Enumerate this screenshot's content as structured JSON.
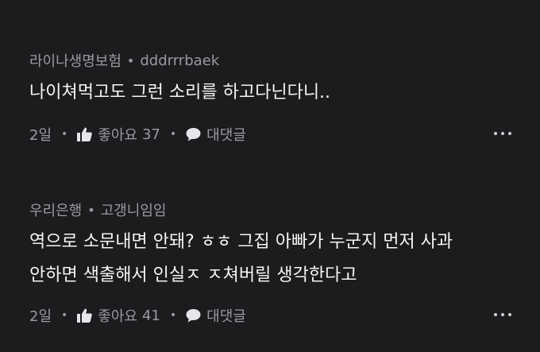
{
  "comments": [
    {
      "group": "라이나생명보험",
      "username": "dddrrrbaek",
      "lines": [
        "나이쳐먹고도 그런 소리를 하고다닌다니.."
      ],
      "time": "2일",
      "like_label": "좋아요",
      "like_count": "37",
      "reply_label": "대댓글"
    },
    {
      "group": "우리은행",
      "username": "고갱니임임",
      "lines": [
        "역으로 소문내면 안돼? ㅎㅎ 그집 아빠가 누군지 먼저 사과",
        "안하면 색출해서 인실ㅈ ㅈ쳐버릴 생각한다고"
      ],
      "time": "2일",
      "like_label": "좋아요",
      "like_count": "41",
      "reply_label": "대댓글"
    }
  ],
  "separator": "•",
  "colors": {
    "background": "#1c1c1e",
    "text": "#f5f5f5",
    "muted": "#9a9a9f"
  },
  "icons": {
    "like": "thumbs-up-icon",
    "reply": "speech-bubble-icon",
    "more": "more-dots-icon"
  }
}
